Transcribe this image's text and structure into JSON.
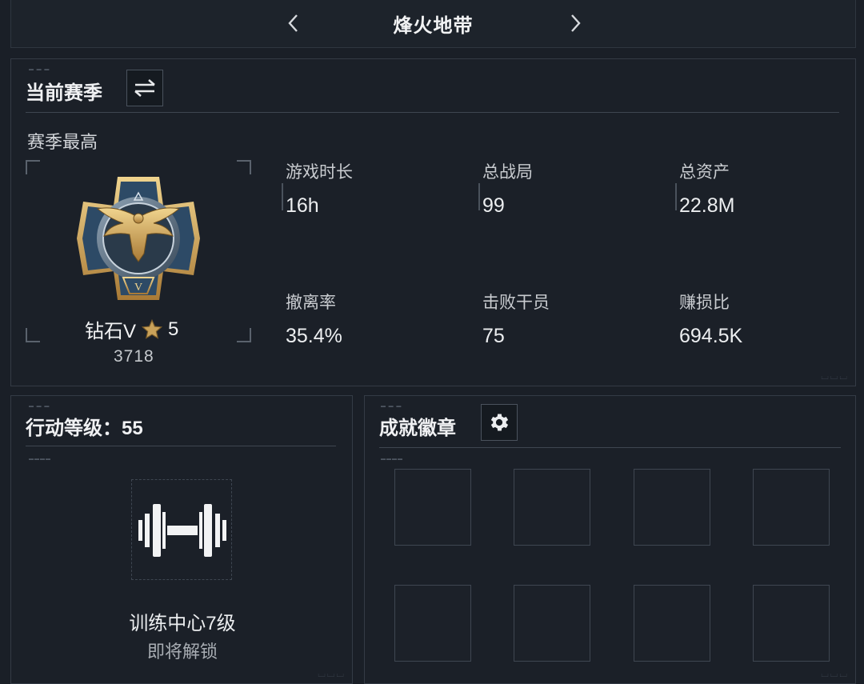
{
  "header": {
    "title": "烽火地带",
    "prev_icon": "chevron-left-icon",
    "next_icon": "chevron-right-icon"
  },
  "season": {
    "title": "当前赛季",
    "switch_icon": "swap-arrows-icon",
    "subtitle": "赛季最高",
    "rank": {
      "name": "钻石V",
      "star_icon": "star-icon",
      "stars": "5",
      "score": "3718",
      "emblem_icon": "eagle-rank-emblem-icon"
    },
    "stats": [
      {
        "label": "游戏时长",
        "value": "16h"
      },
      {
        "label": "总战局",
        "value": "99"
      },
      {
        "label": "总资产",
        "value": "22.8M"
      },
      {
        "label": "撤离率",
        "value": "35.4%"
      },
      {
        "label": "击败干员",
        "value": "75"
      },
      {
        "label": "赚损比",
        "value": "694.5K"
      }
    ]
  },
  "action_level": {
    "title": "行动等级：55",
    "icon": "dumbbell-icon",
    "unlock_name": "训练中心7级",
    "unlock_status": "即将解锁"
  },
  "achievements": {
    "title": "成就徽章",
    "settings_icon": "gear-icon",
    "slots": 8
  },
  "colors": {
    "background": "#1a1f27",
    "panel": "#1b2028",
    "border": "#343b45",
    "text": "#e8eaec",
    "gold": "#c9a25a"
  }
}
